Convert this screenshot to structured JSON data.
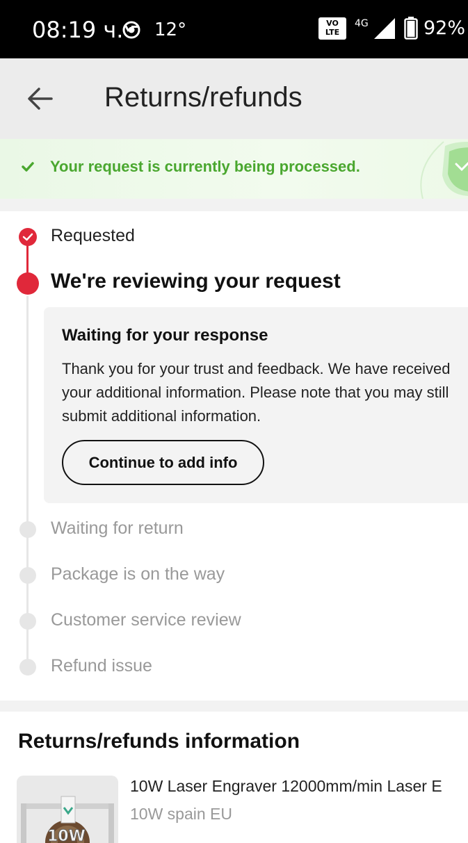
{
  "status_bar": {
    "time": "08:19 ч.",
    "temperature": "12°",
    "volte_top": "VO",
    "volte_bottom": "LTE",
    "network": "4G",
    "battery": "92%",
    "icons": [
      "chrome-icon",
      "volte-icon",
      "signal-icon",
      "battery-icon"
    ]
  },
  "header": {
    "title": "Returns/refunds",
    "back_icon": "arrow-left-icon"
  },
  "banner": {
    "text": "Your request is currently being processed.",
    "accent_color": "#4aa72f"
  },
  "timeline": {
    "accent_color": "#e0283a",
    "steps": [
      {
        "label": "Requested",
        "state": "done"
      },
      {
        "label": "We're reviewing your request",
        "state": "active"
      },
      {
        "label": "Waiting for return",
        "state": "pending"
      },
      {
        "label": "Package is on the way",
        "state": "pending"
      },
      {
        "label": "Customer service review",
        "state": "pending"
      },
      {
        "label": "Refund issue",
        "state": "pending"
      }
    ],
    "card": {
      "title": "Waiting for your response",
      "body": "Thank you for your trust and feedback. We have received your additional information. Please note that you may still submit additional information.",
      "button_label": "Continue to add info"
    }
  },
  "info": {
    "title": "Returns/refunds information",
    "product": {
      "name": "10W Laser Engraver 12000mm/min Laser E",
      "variant": "10W spain EU",
      "thumb_text": "10W"
    }
  }
}
